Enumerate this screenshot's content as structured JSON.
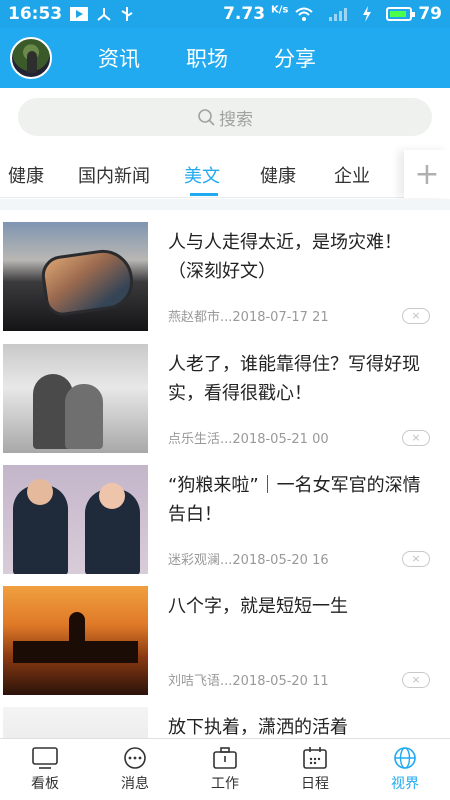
{
  "status_bar": {
    "time": "16:53",
    "network_speed": "7.73",
    "speed_unit": "K/s",
    "battery": "79",
    "icons": [
      "play-icon",
      "share-icon",
      "usb-icon",
      "wifi-icon",
      "signal-icon",
      "charging-icon",
      "battery-icon"
    ]
  },
  "header": {
    "avatar": "avatar",
    "tabs": [
      {
        "label": "资讯"
      },
      {
        "label": "职场"
      },
      {
        "label": "分享"
      }
    ]
  },
  "search": {
    "placeholder": "搜索"
  },
  "categories": {
    "items": [
      {
        "label": "健康"
      },
      {
        "label": "国内新闻"
      },
      {
        "label": "美文"
      },
      {
        "label": "健康"
      },
      {
        "label": "企业"
      }
    ],
    "active": "美文",
    "add_label": "+"
  },
  "articles": [
    {
      "title": "人与人走得太近，是场灾难！（深刻好文）",
      "source": "燕赵都市...",
      "datetime": "2018-07-17 21"
    },
    {
      "title": "人老了，谁能靠得住？写得好现实，看得很戳心！",
      "source": "点乐生活...",
      "datetime": "2018-05-21 00"
    },
    {
      "title": "“狗粮来啦”｜一名女军官的深情告白！",
      "source": "迷彩观澜...",
      "datetime": "2018-05-20 16"
    },
    {
      "title": "八个字，就是短短一生",
      "source": "刘咭飞语...",
      "datetime": "2018-05-20 11"
    },
    {
      "title": "放下执着，潇洒的活着",
      "source": "",
      "datetime": ""
    }
  ],
  "close_label": "×",
  "bottom_nav": [
    {
      "label": "看板",
      "icon": "dashboard-icon"
    },
    {
      "label": "消息",
      "icon": "message-icon"
    },
    {
      "label": "工作",
      "icon": "briefcase-icon"
    },
    {
      "label": "日程",
      "icon": "calendar-icon"
    },
    {
      "label": "视界",
      "icon": "globe-icon",
      "active": true
    }
  ],
  "colors": {
    "accent": "#22aaf0",
    "status_bar": "#1fa6ea"
  }
}
